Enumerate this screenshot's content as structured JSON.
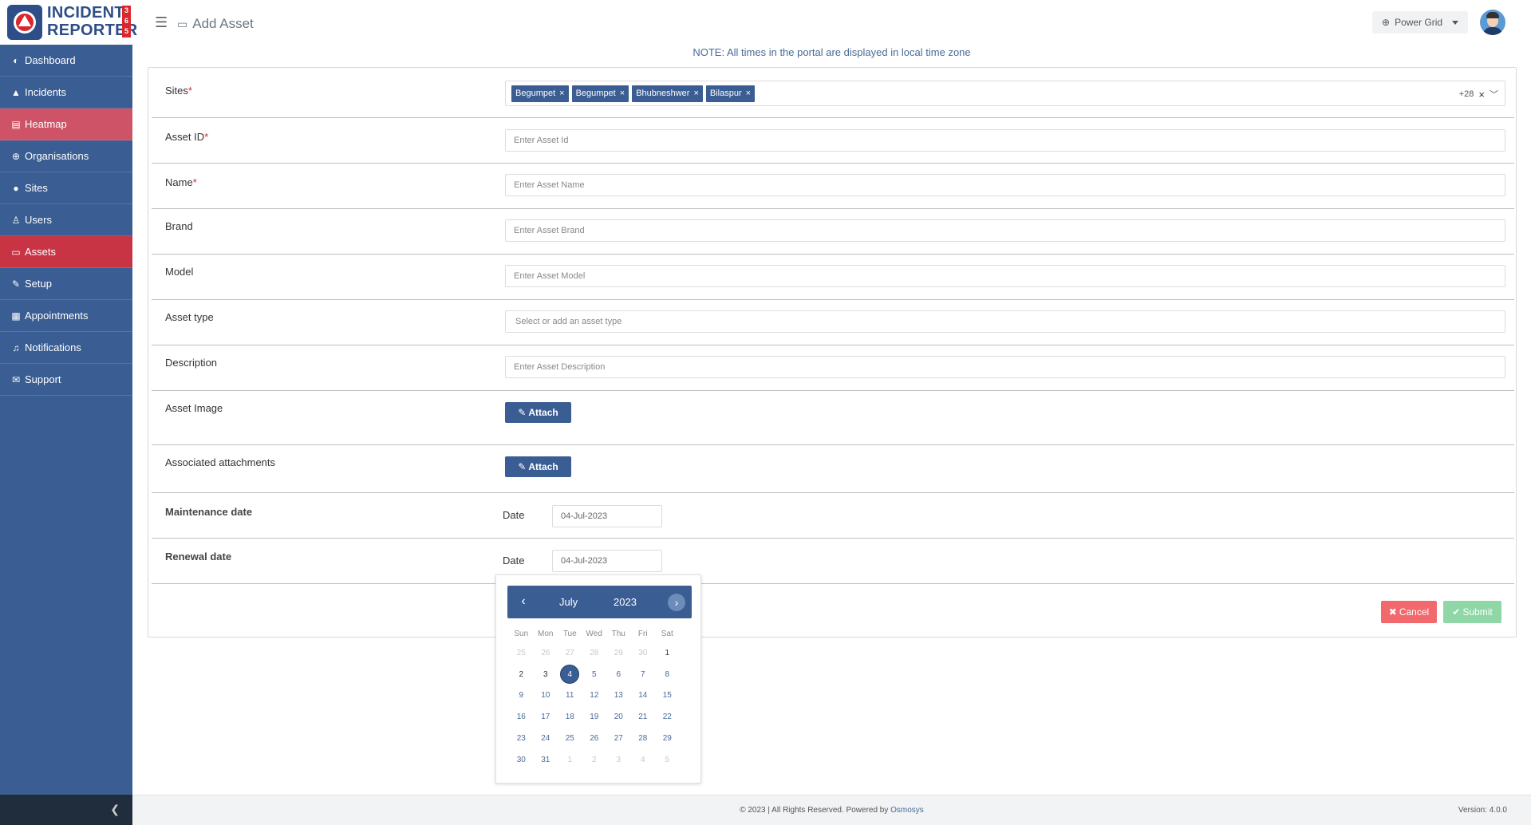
{
  "app": {
    "logo_line1": "INCIDENT",
    "logo_line2": "REPORTER",
    "logo_365": "3\n6\n5"
  },
  "sidebar": {
    "items": [
      {
        "label": "Dashboard",
        "icon": "dashboard-icon"
      },
      {
        "label": "Incidents",
        "icon": "warning-icon"
      },
      {
        "label": "Heatmap",
        "icon": "map-icon"
      },
      {
        "label": "Organisations",
        "icon": "globe-icon"
      },
      {
        "label": "Sites",
        "icon": "globe-solid-icon"
      },
      {
        "label": "Users",
        "icon": "users-icon"
      },
      {
        "label": "Assets",
        "icon": "laptop-icon"
      },
      {
        "label": "Setup",
        "icon": "wrench-icon"
      },
      {
        "label": "Appointments",
        "icon": "calendar-icon"
      },
      {
        "label": "Notifications",
        "icon": "bell-icon"
      },
      {
        "label": "Support",
        "icon": "envelope-icon"
      }
    ],
    "active": "Assets"
  },
  "header": {
    "title": "Add Asset",
    "org_select": "Power Grid"
  },
  "note": "NOTE: All times in the portal are displayed in local time zone",
  "form": {
    "sites": {
      "label": "Sites",
      "tags": [
        "Begumpet",
        "Begumpet",
        "Bhubneshwer",
        "Bilaspur"
      ],
      "more": "+28"
    },
    "asset_id": {
      "label": "Asset ID",
      "placeholder": "Enter Asset Id"
    },
    "name": {
      "label": "Name",
      "placeholder": "Enter Asset Name"
    },
    "brand": {
      "label": "Brand",
      "placeholder": "Enter Asset Brand"
    },
    "model": {
      "label": "Model",
      "placeholder": "Enter Asset Model"
    },
    "asset_type": {
      "label": "Asset type",
      "placeholder": "Select or add an asset type"
    },
    "description": {
      "label": "Description",
      "placeholder": "Enter Asset Description"
    },
    "asset_image": {
      "label": "Asset Image",
      "button": "Attach"
    },
    "attachments": {
      "label": "Associated attachments",
      "button": "Attach"
    },
    "maintenance": {
      "label": "Maintenance date",
      "date_label": "Date",
      "value": "04-Jul-2023"
    },
    "renewal": {
      "label": "Renewal date",
      "date_label": "Date",
      "value": "04-Jul-2023"
    },
    "cancel_label": "Cancel",
    "submit_label": "Submit"
  },
  "calendar": {
    "month": "July",
    "year": "2023",
    "prev": "‹",
    "next": "›",
    "dow": [
      "Sun",
      "Mon",
      "Tue",
      "Wed",
      "Thu",
      "Fri",
      "Sat"
    ],
    "weeks": [
      [
        "25",
        "26",
        "27",
        "28",
        "29",
        "30",
        "1"
      ],
      [
        "2",
        "3",
        "4",
        "5",
        "6",
        "7",
        "8"
      ],
      [
        "9",
        "10",
        "11",
        "12",
        "13",
        "14",
        "15"
      ],
      [
        "16",
        "17",
        "18",
        "19",
        "20",
        "21",
        "22"
      ],
      [
        "23",
        "24",
        "25",
        "26",
        "27",
        "28",
        "29"
      ],
      [
        "30",
        "31",
        "1",
        "2",
        "3",
        "4",
        "5"
      ]
    ],
    "selected": "4"
  },
  "footer": {
    "copyright": "© 2023 | All Rights Reserved. Powered by ",
    "company": "Osmosys",
    "version": "Version: 4.0.0"
  },
  "colors": {
    "sidebar": "#3a5d93",
    "active": "#c93445",
    "heatmap": "#cf5366",
    "cancel": "#f2696d",
    "submit": "#8fd7a7"
  }
}
